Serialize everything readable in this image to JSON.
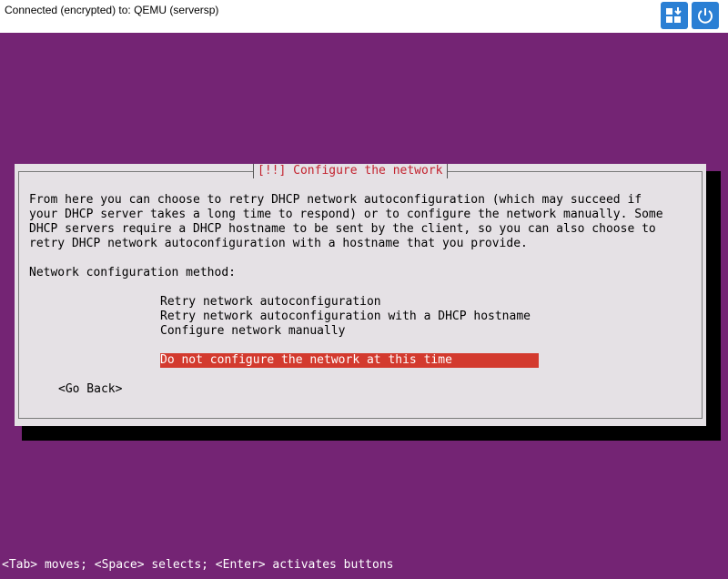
{
  "window": {
    "connection_status": "Connected (encrypted) to: QEMU (serversp)"
  },
  "toolbar": {
    "buttons": [
      {
        "name": "send-keys-icon"
      },
      {
        "name": "power-icon"
      }
    ]
  },
  "dialog": {
    "title": "[!!] Configure the network",
    "description_lines": [
      "From here you can choose to retry DHCP network autoconfiguration (which may succeed if",
      "your DHCP server takes a long time to respond) or to configure the network manually. Some",
      "DHCP servers require a DHCP hostname to be sent by the client, so you can also choose to",
      "retry DHCP network autoconfiguration with a hostname that you provide."
    ],
    "method_label": "Network configuration method:",
    "options": [
      "Retry network autoconfiguration",
      "Retry network autoconfiguration with a DHCP hostname",
      "Configure network manually"
    ],
    "selected_option": "Do not configure the network at this time",
    "go_back": "<Go Back>"
  },
  "status_bar": {
    "text": "<Tab> moves; <Space> selects; <Enter> activates buttons"
  },
  "colors": {
    "background": "#742474",
    "dialog": "#e5e1e5",
    "title": "#c3222e",
    "selection": "#d33a2e",
    "toolbar_button": "#2a7fd4"
  }
}
